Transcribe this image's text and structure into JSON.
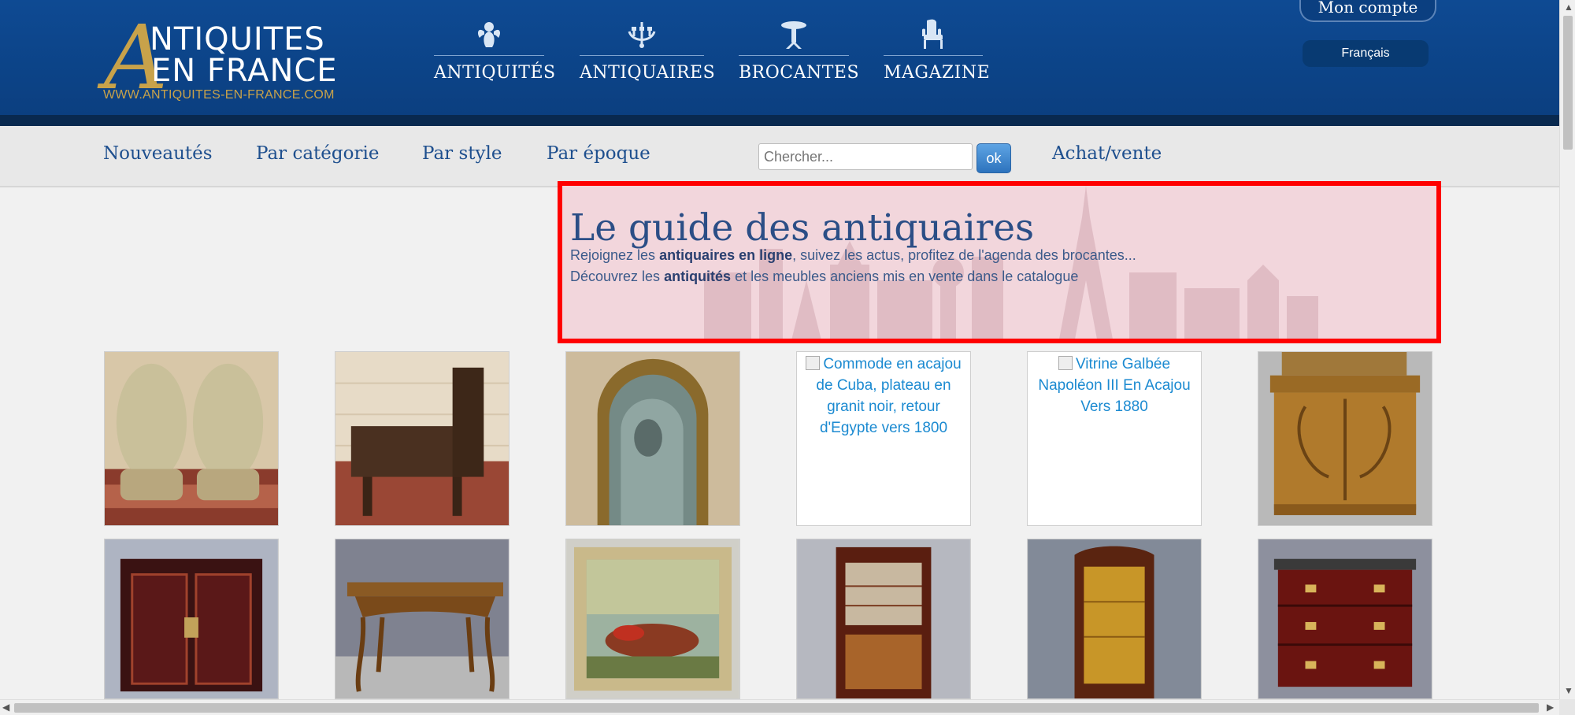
{
  "logo": {
    "letter": "A",
    "line1": "NTIQUITES",
    "line2": "EN FRANCE",
    "url": "WWW.ANTIQUITES-EN-FRANCE.COM"
  },
  "nav": [
    {
      "label": "ANTIQUITÉS",
      "icon": "angel-icon"
    },
    {
      "label": "ANTIQUAIRES",
      "icon": "chandelier-icon"
    },
    {
      "label": "BROCANTES",
      "icon": "pedestal-table-icon"
    },
    {
      "label": "MAGAZINE",
      "icon": "armchair-icon"
    }
  ],
  "account_label": "Mon compte",
  "language": "Français",
  "subnav": {
    "new": "Nouveautés",
    "category": "Par catégorie",
    "style": "Par style",
    "period": "Par époque",
    "buysell": "Achat/vente"
  },
  "search": {
    "placeholder": "Chercher...",
    "button": "ok"
  },
  "hero": {
    "title": "Le guide des antiquaires",
    "line1_pre": "Rejoignez les ",
    "line1_bold": "antiquaires en ligne",
    "line1_post": ", suivez les actus, profitez de l'agenda des brocantes...",
    "line2_pre": "Découvrez les ",
    "line2_bold": "antiquités",
    "line2_post": " et les meubles anciens mis en vente dans le catalogue"
  },
  "products": [
    {
      "alt": "",
      "kind": "bergeres"
    },
    {
      "alt": "",
      "kind": "leather-armchair"
    },
    {
      "alt": "",
      "kind": "mirror"
    },
    {
      "alt": "Commode en acajou de Cuba, plateau en granit noir, retour d'Egypte vers 1800",
      "kind": "broken"
    },
    {
      "alt": "Vitrine Galbée Napoléon III En Acajou Vers 1880",
      "kind": "broken"
    },
    {
      "alt": "",
      "kind": "art-nouveau-cabinet"
    },
    {
      "alt": "",
      "kind": "lacquer-cabinet"
    },
    {
      "alt": "",
      "kind": "provencal-table"
    },
    {
      "alt": "",
      "kind": "painting"
    },
    {
      "alt": "",
      "kind": "display-cabinet"
    },
    {
      "alt": "",
      "kind": "vitrine"
    },
    {
      "alt": "",
      "kind": "chest-of-drawers"
    }
  ],
  "colors": {
    "header_blue": "#0e4a93",
    "gold": "#c8a24a",
    "link_blue": "#1e4f8e",
    "highlight_border": "#ff0000"
  }
}
